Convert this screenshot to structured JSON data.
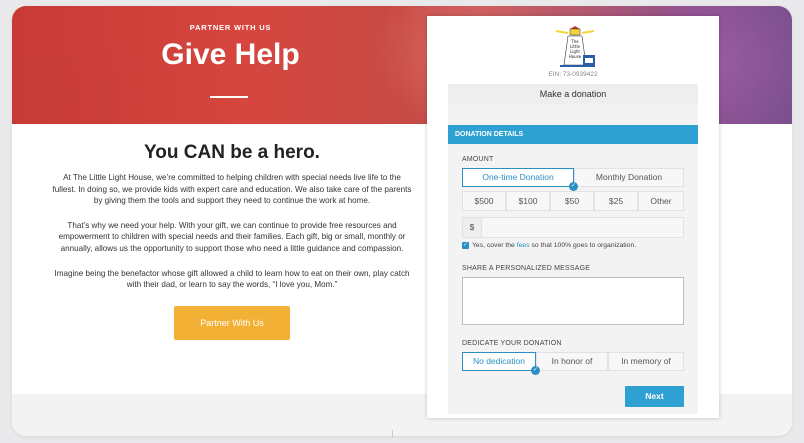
{
  "hero": {
    "kicker": "PARTNER WITH US",
    "title": "Give Help"
  },
  "main": {
    "heading": "You CAN be a hero.",
    "paragraphs": [
      "At The Little Light House, we’re committed to helping children with special needs live life to the fullest. In doing so, we provide kids with expert care and education. We also take care of the parents by giving them the tools and support they need to continue the work at home.",
      "That’s why we need your help. With your gift, we can continue to provide free resources and empowerment to children with special needs and their families. Each gift, big or small, monthly or annually, allows us the opportunity to support those who need a little guidance and compassion.",
      "Imagine being the benefactor whose gift allowed a child to learn how to eat on their own, play catch with their dad, or learn to say the words, “I love you, Mom.”"
    ],
    "cta_label": "Partner With Us"
  },
  "widget": {
    "logo_text": [
      "The",
      "Little",
      "Light",
      "House"
    ],
    "ein": "EIN: 73-0939422",
    "header": "Make a donation",
    "section_title": "DONATION DETAILS",
    "amount_label": "AMOUNT",
    "frequency_options": [
      "One-time Donation",
      "Monthly Donation"
    ],
    "frequency_selected": "One-time Donation",
    "amounts": [
      "$500",
      "$100",
      "$50",
      "$25",
      "Other"
    ],
    "currency_symbol": "$",
    "amount_value": "",
    "fees_text_before": "Yes, cover the ",
    "fees_link": "fees",
    "fees_text_after": " so that 100% goes to organization.",
    "message_label": "SHARE A PERSONALIZED MESSAGE",
    "message_value": "",
    "dedicate_label": "DEDICATE YOUR DONATION",
    "dedication_options": [
      "No dedication",
      "In honor of",
      "In memory of"
    ],
    "dedication_selected": "No dedication",
    "next_label": "Next"
  },
  "colors": {
    "accent_blue": "#2ea1d2",
    "cta_yellow": "#f2b134",
    "hero_red": "#d6463f"
  }
}
